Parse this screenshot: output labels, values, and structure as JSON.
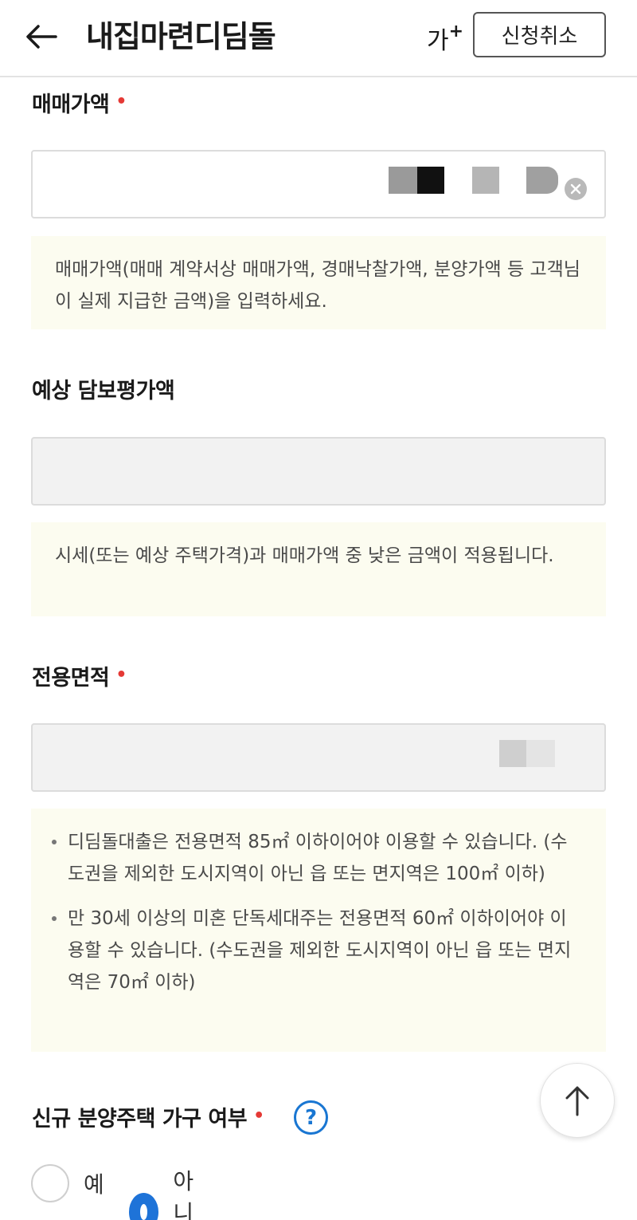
{
  "header": {
    "title": "내집마련디딤돌",
    "font_size_label": "가",
    "font_size_plus": "+",
    "cancel_label": "신청취소"
  },
  "purchase_price": {
    "label": "매매가액",
    "required_mark": "•",
    "help": "매매가액(매매 계약서상 매매가액, 경매낙찰가액, 분양가액 등 고객님이 실제 지급한 금액)을 입력하세요."
  },
  "appraisal": {
    "label": "예상 담보평가액",
    "help": "시세(또는 예상 주택가격)과 매매가액 중 낮은 금액이 적용됩니다."
  },
  "area": {
    "label": "전용면적",
    "required_mark": "•",
    "bullets": [
      "디딤돌대출은 전용면적 85㎡ 이하이어야 이용할 수 있습니다. (수도권을 제외한 도시지역이 아닌 읍 또는 면지역은 100㎡ 이하)",
      "만 30세 이상의 미혼 단독세대주는 전용면적 60㎡ 이하이어야 이용할 수 있습니다. (수도권을 제외한 도시지역이 아닌 읍 또는 면지역은 70㎡ 이하)"
    ]
  },
  "new_house": {
    "label": "신규 분양주택 가구 여부",
    "required_mark": "•",
    "help_icon": "?",
    "options": [
      "예",
      "아니오"
    ],
    "selected": "아니오"
  },
  "colors": {
    "accent": "#1e73d8",
    "required": "#e53935",
    "help_bg": "#fcfcf0"
  },
  "icons": {
    "back": "arrow-left-icon",
    "clear": "clear-icon",
    "help": "question-icon",
    "scroll_top": "arrow-up-icon"
  }
}
